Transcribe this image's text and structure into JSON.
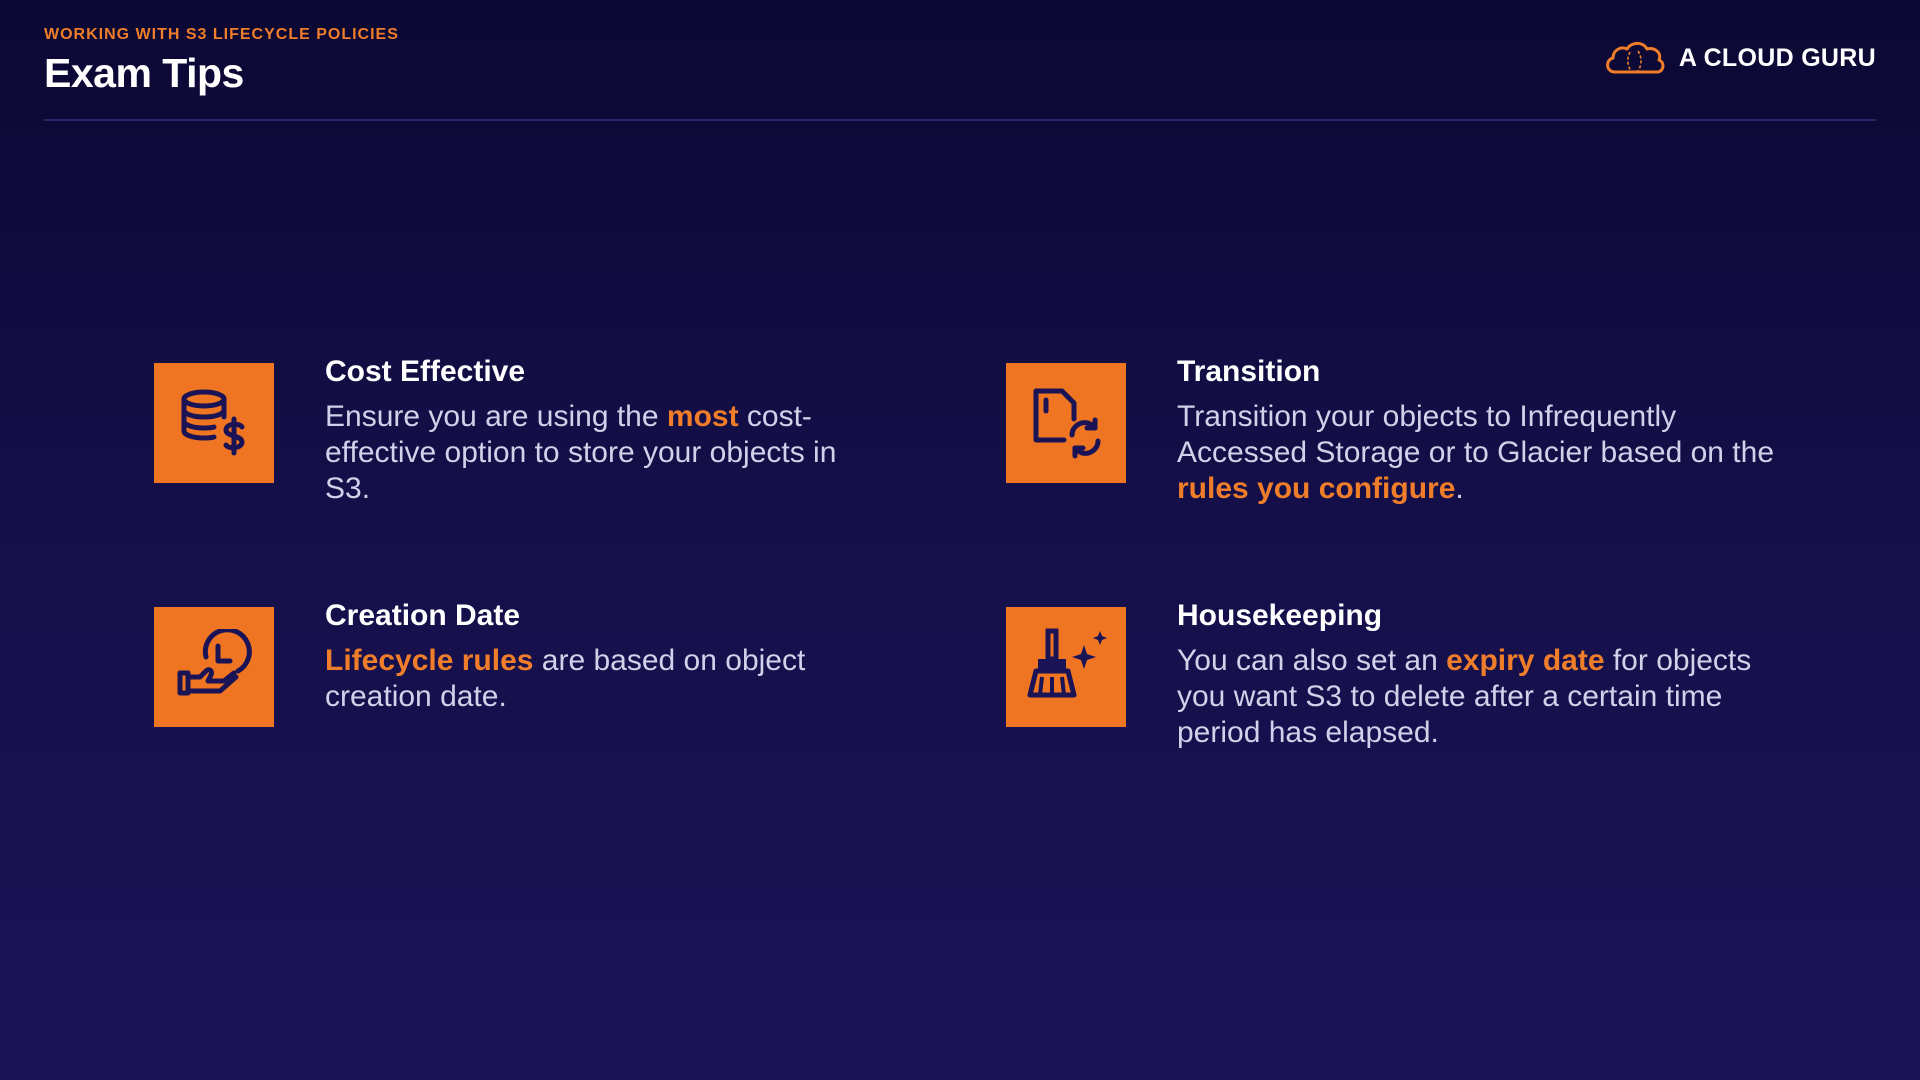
{
  "header": {
    "eyebrow": "WORKING WITH S3 LIFECYCLE POLICIES",
    "title": "Exam Tips",
    "brand": "A CLOUD GURU"
  },
  "tips": [
    {
      "icon": "database-dollar-icon",
      "title": "Cost Effective",
      "text": {
        "before": "Ensure you are using the ",
        "highlight": "most",
        "after": " cost-effective option to store your objects in S3."
      }
    },
    {
      "icon": "file-sync-icon",
      "title": "Transition",
      "text": {
        "before": "Transition your objects to Infrequently Accessed Storage or to Glacier based on the ",
        "highlight": "rules you configure",
        "after": "."
      }
    },
    {
      "icon": "clock-hand-icon",
      "title": "Creation Date",
      "text": {
        "before": "",
        "highlight": "Lifecycle rules",
        "after": " are based on object creation date."
      }
    },
    {
      "icon": "broom-sparkle-icon",
      "title": "Housekeeping",
      "text": {
        "before": "You can also set an ",
        "highlight": "expiry date",
        "after": " for objects you want S3 to delete after a certain time period has elapsed."
      }
    }
  ],
  "colors": {
    "accent": "#ef7523",
    "background": "#140f48",
    "icon_stroke": "#1a1456"
  }
}
